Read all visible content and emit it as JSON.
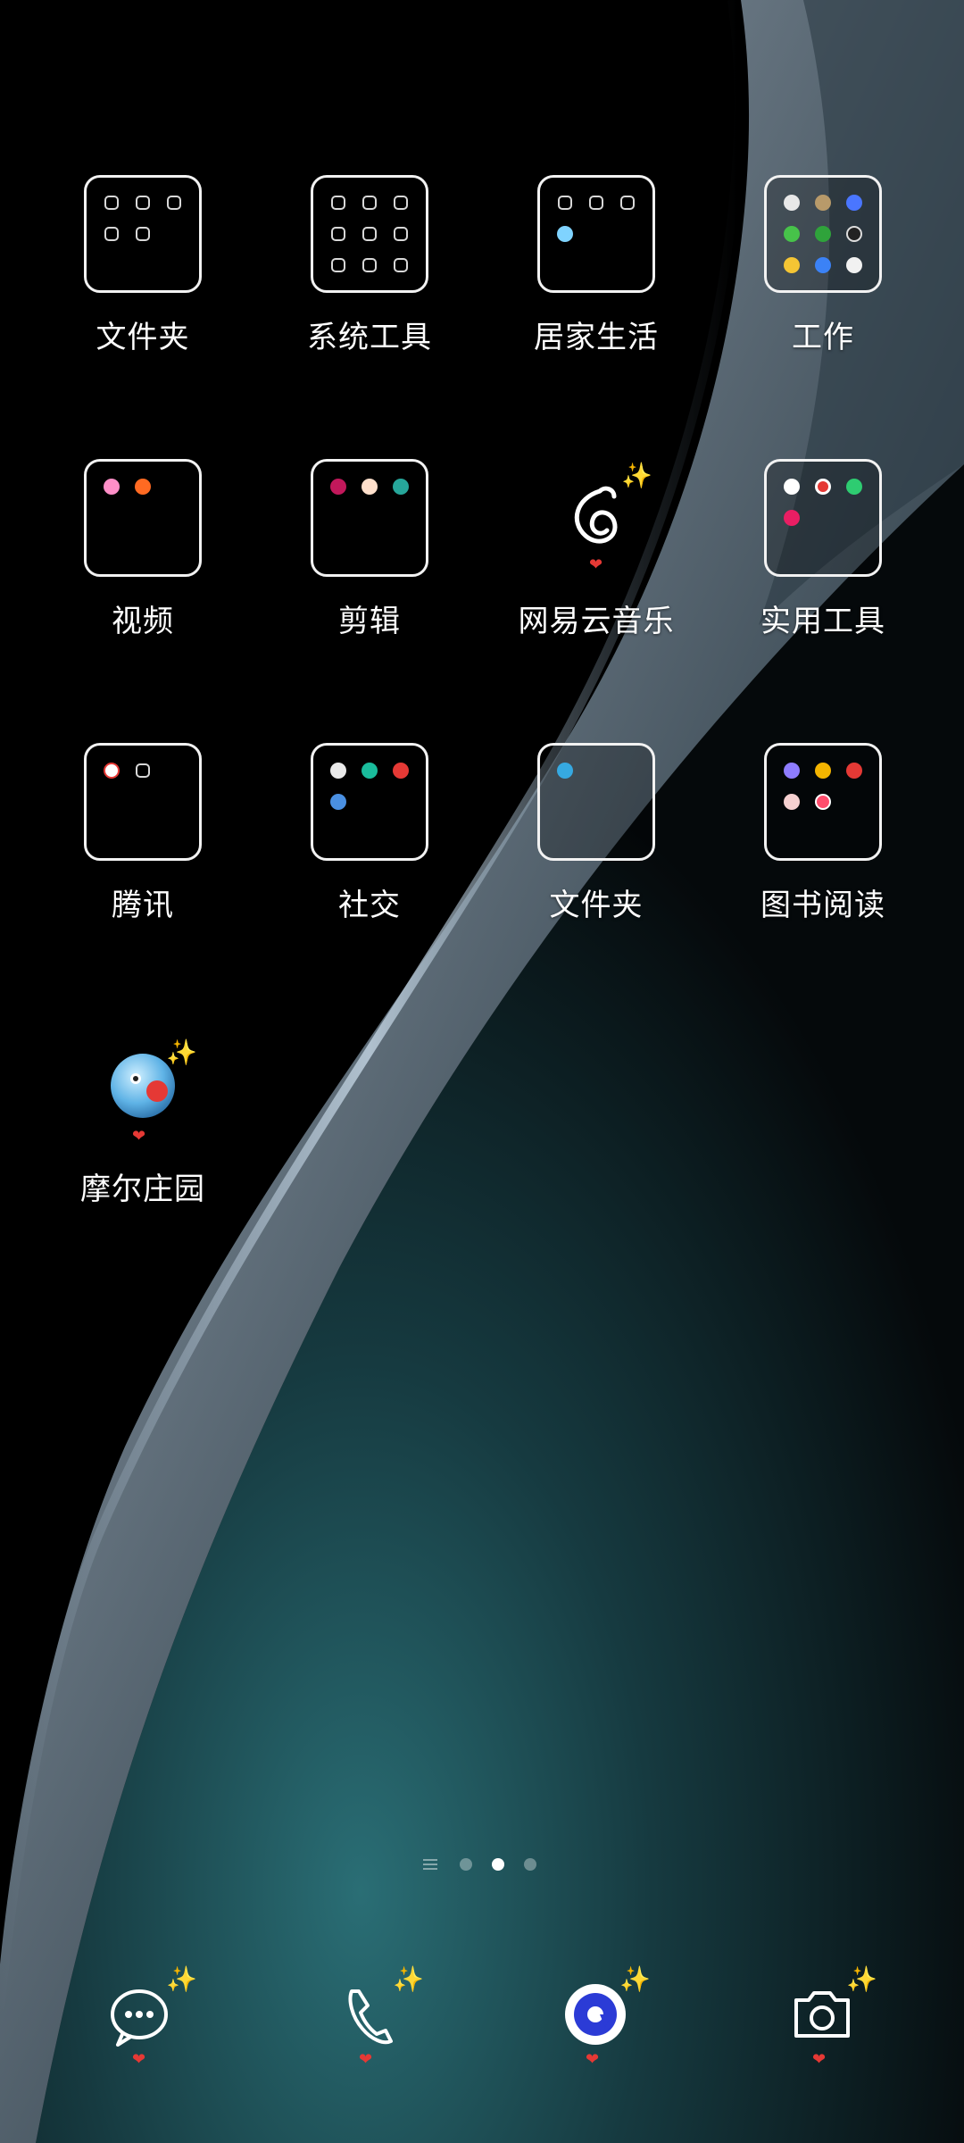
{
  "home": {
    "folders": [
      {
        "label": "文件夹"
      },
      {
        "label": "系统工具"
      },
      {
        "label": "居家生活"
      },
      {
        "label": "工作"
      },
      {
        "label": "视频"
      },
      {
        "label": "剪辑"
      },
      {
        "label": "网易云音乐"
      },
      {
        "label": "实用工具"
      },
      {
        "label": "腾讯"
      },
      {
        "label": "社交"
      },
      {
        "label": "文件夹"
      },
      {
        "label": "图书阅读"
      },
      {
        "label": "摩尔庄园"
      }
    ]
  },
  "page_indicator": {
    "pages": 3,
    "current": 2
  },
  "dock": {
    "icons": [
      "messages-icon",
      "phone-icon",
      "browser-icon",
      "camera-icon"
    ]
  },
  "colors": {
    "accent_browser": "#2b3bd6",
    "sparkle": "#ffd54a",
    "heart": "#e53935",
    "wallpaper_teal": "#2a6e75"
  }
}
